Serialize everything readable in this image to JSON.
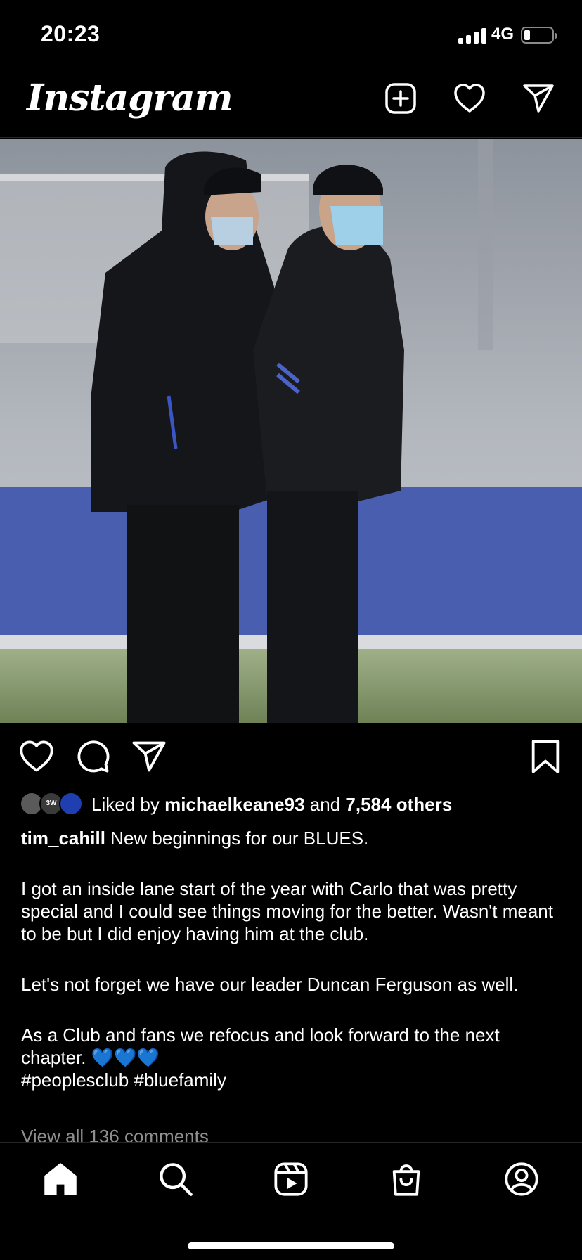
{
  "status": {
    "time": "20:23",
    "network": "4G"
  },
  "header": {
    "logo": "Instagram"
  },
  "likes": {
    "prefix": "Liked by",
    "user": "michaelkeane93",
    "and": "and",
    "others": "7,584 others",
    "avatar_badge": "3W"
  },
  "caption": {
    "username": "tim_cahill",
    "line1": "New beginnings for our BLUES.",
    "para2": "I got an inside lane start of the year with Carlo that was pretty special and I could see things moving for the better. Wasn't meant to be but I did enjoy having him at the club.",
    "para3": "Let's not forget we have our leader Duncan Ferguson as well.",
    "para4": "As a Club and fans we refocus and look forward to the next chapter.",
    "hearts": "💙💙💙",
    "hashtags": "#peoplesclub #bluefamily"
  },
  "comments": {
    "view_all": "View all 136 comments"
  },
  "colors": {
    "background": "#000000",
    "text": "#ffffff",
    "muted": "#8e8e8e",
    "heart_blue": "#1877f2"
  },
  "icons": {
    "header": [
      "new-post-icon",
      "heart-icon",
      "direct-message-icon"
    ],
    "actions": [
      "like-icon",
      "comment-icon",
      "share-icon",
      "save-icon"
    ],
    "tabs": [
      "home-icon",
      "search-icon",
      "reels-icon",
      "shop-icon",
      "profile-icon"
    ]
  }
}
